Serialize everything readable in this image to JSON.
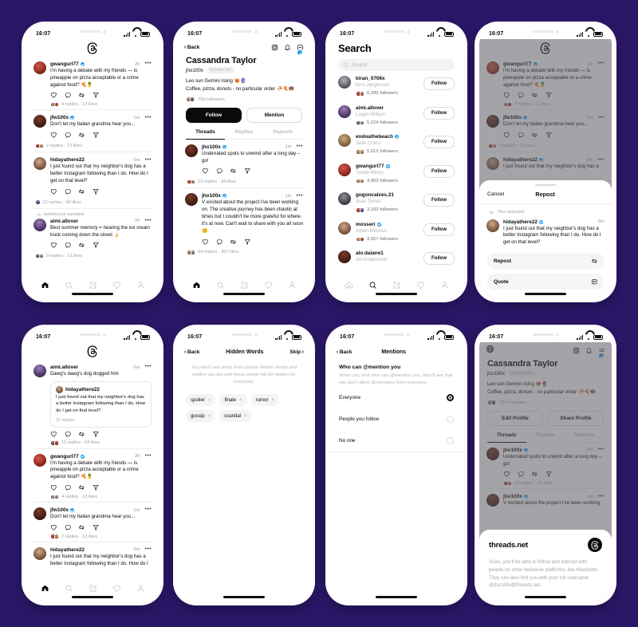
{
  "background_color": "#2b1768",
  "status_bar": {
    "time": "16:07"
  },
  "icons": {
    "threads_logo": "threads-logo-icon",
    "back": "chevron-left-icon",
    "instagram": "instagram-icon",
    "bell": "bell-icon",
    "more_circle": "more-circle-icon",
    "menu": "hamburger-menu-icon",
    "globe": "globe-icon",
    "search": "search-icon",
    "like": "heart-icon",
    "reply": "comment-icon",
    "repost": "repost-icon",
    "share": "send-icon",
    "home": "home-icon",
    "compose": "compose-icon",
    "activity": "heart-icon",
    "profile": "person-icon",
    "quote": "quote-icon"
  },
  "phone1": {
    "name": "feed-screen",
    "posts": [
      {
        "username": "gwangurl77",
        "verified": true,
        "time": "2h",
        "text": "I'm having a debate with my friends — is pineapple on pizza acceptable or a crime against food? 🍕🍍",
        "meta": "4 replies · 12 likes",
        "avatar": "a1"
      },
      {
        "username": "jfw100x",
        "verified": true,
        "time": "1m",
        "text": "Don't let my Italian grandma hear you...",
        "meta": "2 replies · 12 likes",
        "avatar": "a2"
      },
      {
        "username": "hidayathere22",
        "verified": false,
        "time": "6m",
        "text": "I just found out that my neighbor's dog has a better Instagram following than I do. How do I get on that level?",
        "meta": "12 replies · 94 likes",
        "avatar": "a3"
      },
      {
        "repost_label": "tarekinyoui reposted",
        "username": "aimi.allover",
        "verified": false,
        "time": "2h",
        "text": "Best summer memory = hearing the ice cream truck coming down the street 🍦",
        "meta": "3 replies · 12 likes",
        "avatar": "a4"
      }
    ]
  },
  "phone2": {
    "name": "profile-screen",
    "nav": {
      "back": "Back"
    },
    "profile": {
      "display_name": "Cassandra Taylor",
      "handle": "jho100x",
      "chip": "threads.net",
      "bio_line1": "Leo sun Gemini rising 😻🔮",
      "bio_line2": "Coffee, pizza, donuts - no particular order 🍜🍕🍩",
      "followers": "75k followers",
      "verified": true
    },
    "buttons": {
      "primary": "Follow",
      "secondary": "Mention"
    },
    "tabs": [
      "Threads",
      "Replies",
      "Reposts"
    ],
    "active_tab": "Threads",
    "posts": [
      {
        "username": "jho100x",
        "verified": true,
        "time": "1m",
        "text": "Underrated spots to unwind after a long day – go!",
        "meta": "19 replies · 84 likes",
        "avatar": "a2"
      },
      {
        "username": "jho100x",
        "verified": true,
        "time": "1m",
        "text": "V excited about the project I've been working on. The creative journey has been chaotic at times but I couldn't be more grateful for where it's at now. Can't wait to share with you all soon 😊",
        "meta": "64 replies · 357 likes",
        "avatar": "a2"
      }
    ]
  },
  "phone3": {
    "name": "search-screen",
    "title": "Search",
    "search_placeholder": "Search",
    "follow_label": "Follow",
    "results": [
      {
        "username": "kiran_0706x",
        "real_name": "Kirsi Jørgensen",
        "followers": "6,290 followers",
        "verified": false,
        "avatar": "a5"
      },
      {
        "username": "aimi.allover",
        "real_name": "Logan Wilson",
        "followers": "5,124 followers",
        "verified": false,
        "avatar": "a4"
      },
      {
        "username": "endoathebeach",
        "real_name": "Jade Greco",
        "followers": "5,012 followers",
        "verified": true,
        "avatar": "a6"
      },
      {
        "username": "gwangurl77",
        "real_name": "Yvette Mistry",
        "followers": "4,903 followers",
        "verified": true,
        "avatar": "a1"
      },
      {
        "username": "gogoncalves.21",
        "real_name": "Juan Torres",
        "followers": "3,192 followers",
        "verified": false,
        "avatar": "a7"
      },
      {
        "username": "mosseri",
        "real_name": "Adam Mosseri",
        "followers": "3,027 followers",
        "verified": true,
        "avatar": "a3"
      },
      {
        "username": "alo.daiane1",
        "real_name": "Airi Andersson",
        "followers": "",
        "verified": false,
        "avatar": "a2"
      }
    ]
  },
  "phone4": {
    "name": "repost-sheet-screen",
    "sheet": {
      "cancel": "Cancel",
      "title": "Repost",
      "reposted_note": "You reposted",
      "quoted_post": {
        "username": "hidayathere22",
        "verified": true,
        "time": "6m",
        "text": "I just found out that my neighbor's dog has a better Instagram following than I do. How do I get on that level?"
      },
      "options": [
        {
          "label": "Repost",
          "icon": "repost-icon"
        },
        {
          "label": "Quote",
          "icon": "quote-icon"
        }
      ]
    },
    "background_posts": [
      {
        "username": "gwangurl77",
        "verified": true,
        "time": "2h",
        "text": "I'm having a debate with my friends — is pineapple on pizza acceptable or a crime against food? 🍕🍍",
        "meta": "4 replies · 12 likes",
        "avatar": "a1"
      },
      {
        "username": "jfw100x",
        "verified": true,
        "time": "1m",
        "text": "Don't let my Italian grandma hear you...",
        "meta": "2 replies · 12 likes",
        "avatar": "a2"
      },
      {
        "username": "hidayathere22",
        "verified": true,
        "time": "6m",
        "text": "I just found out that my neighbor's dog has a",
        "meta": "",
        "avatar": "a3"
      }
    ]
  },
  "phone5": {
    "name": "thread-feed-screen",
    "posts": [
      {
        "username": "aimi.allover",
        "verified": false,
        "time": "6m",
        "text": "Dawg's dawg's dog dogged him",
        "meta": "12 replies · 64 likes",
        "avatar": "a4",
        "quote": {
          "username": "hidayathere22",
          "text": "I just found out that my neighbor's dog has a better Instagram following than I do. How do I get on that level?",
          "meta": "12 replies",
          "avatar": "a3"
        }
      },
      {
        "username": "gwangurl77",
        "verified": true,
        "time": "2h",
        "text": "I'm having a debate with my friends — is pineapple on pizza acceptable or a crime against food? 🍕🍍",
        "meta": "4 replies · 12 likes",
        "avatar": "a1"
      },
      {
        "username": "jfw100x",
        "verified": true,
        "time": "1m",
        "text": "Don't let my Italian grandma hear you...",
        "meta": "2 replies · 12 likes",
        "avatar": "a2"
      },
      {
        "username": "hidayathere22",
        "verified": false,
        "time": "6m",
        "text": "I just found out that my neighbor's dog has a better Instagram following than I do. How do I",
        "meta": "",
        "avatar": "a3"
      }
    ]
  },
  "phone6": {
    "name": "hidden-words-screen",
    "nav": {
      "back": "Back",
      "title": "Hidden Words",
      "skip": "Skip"
    },
    "description": "You won't see posts that contain hidden words and replies you get with these words will be hidden for everyone.",
    "chips": [
      "spoiler",
      "finale",
      "rumor",
      "gossip",
      "scandal"
    ]
  },
  "phone7": {
    "name": "mentions-settings-screen",
    "nav": {
      "back": "Back",
      "title": "Mentions"
    },
    "heading": "Who can @mention you",
    "description": "When you limit who can @mention you, they'll see that you don't allow @mentions from everyone.",
    "options": [
      {
        "label": "Everyone",
        "selected": true
      },
      {
        "label": "People you follow",
        "selected": false
      },
      {
        "label": "No one",
        "selected": false
      }
    ]
  },
  "phone8": {
    "name": "own-profile-fediverse-screen",
    "profile": {
      "display_name": "Cassandra Taylor",
      "handle": "jho100x",
      "chip": "threads.net",
      "bio_line1": "Leo sun Gemini rising 😻🔮",
      "bio_line2": "Coffee, pizza, donuts - no particular order 🍜🍕🍩",
      "followers": "75k followers",
      "verified": true
    },
    "buttons": {
      "primary": "Edit Profile",
      "secondary": "Share Profile"
    },
    "tabs": [
      "Threads",
      "Replies",
      "Reposts"
    ],
    "active_tab": "Threads",
    "posts": [
      {
        "username": "jho100x",
        "verified": true,
        "time": "1m",
        "text": "Underrated spots to unwind after a long day – go!",
        "meta": "19 replies · 64 likes",
        "avatar": "a2"
      },
      {
        "username": "jho100x",
        "verified": true,
        "time": "1m",
        "text": "V excited about the project I've been working",
        "meta": "",
        "avatar": "a2"
      }
    ],
    "fediverse": {
      "title": "threads.net",
      "body": "Soon, you'll be able to follow and interact with people on other fediverse platforms, like Mastodon. They can also find you with your full username @jho100x@threads.net."
    }
  }
}
